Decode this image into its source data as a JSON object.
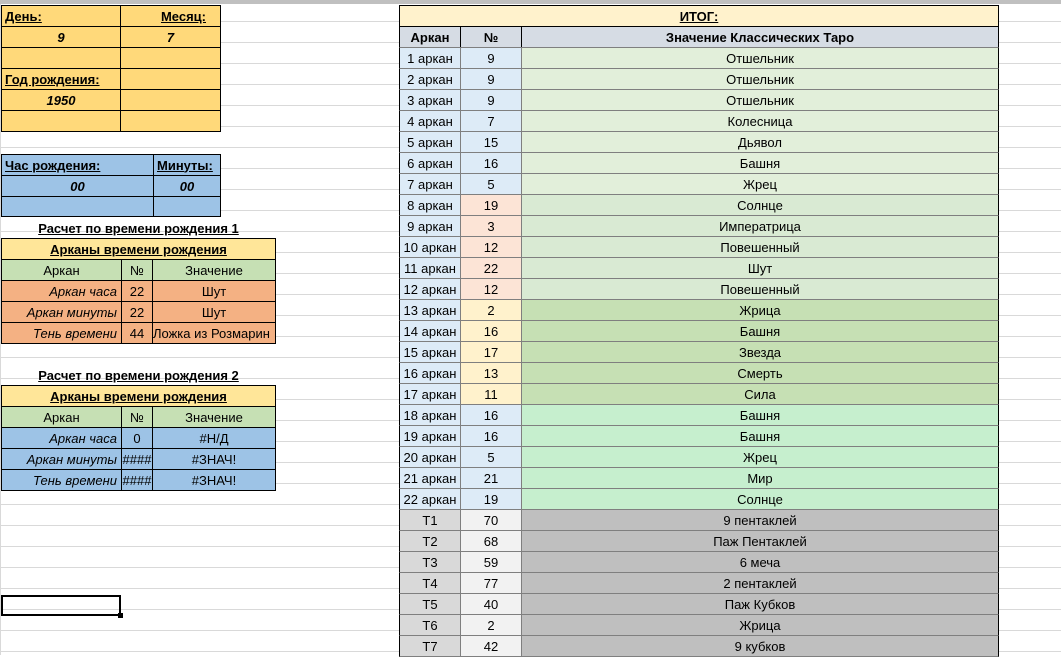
{
  "birth": {
    "day_label": "День:",
    "month_label": "Месяц:",
    "day_value": "9",
    "month_value": "7",
    "year_label": "Год рождения:",
    "year_value": "1950",
    "hour_label": "Час рождения:",
    "minutes_label": "Минуты:",
    "hour_value": "00",
    "minutes_value": "00"
  },
  "calc1": {
    "title": "Расчет по времени рождения 1",
    "header": "Арканы времени рождения",
    "col_arcan": "Аркан",
    "col_num": "№",
    "col_value": "Значение",
    "rows": [
      {
        "label": "Аркан часа",
        "num": "22",
        "value": "Шут"
      },
      {
        "label": "Аркан минуты",
        "num": "22",
        "value": "Шут"
      },
      {
        "label": "Тень времени",
        "num": "44",
        "value": "Ложка из Розмарин"
      }
    ]
  },
  "calc2": {
    "title": "Расчет по времени рождения 2",
    "header": "Арканы времени рождения",
    "col_arcan": "Аркан",
    "col_num": "№",
    "col_value": "Значение",
    "rows": [
      {
        "label": "Аркан часа",
        "num": "0",
        "value": "#Н/Д"
      },
      {
        "label": "Аркан минуты",
        "num": "####",
        "value": "#ЗНАЧ!"
      },
      {
        "label": "Тень времени",
        "num": "####",
        "value": "#ЗНАЧ!"
      }
    ]
  },
  "result": {
    "title": "ИТОГ:",
    "col_arcan": "Аркан",
    "col_num": "№",
    "col_meaning": "Значение Классических Таро",
    "rows": [
      {
        "arcan": "1 аркан",
        "num": "9",
        "meaning": "Отшельник"
      },
      {
        "arcan": "2 аркан",
        "num": "9",
        "meaning": "Отшельник"
      },
      {
        "arcan": "3 аркан",
        "num": "9",
        "meaning": "Отшельник"
      },
      {
        "arcan": "4 аркан",
        "num": "7",
        "meaning": "Колесница"
      },
      {
        "arcan": "5 аркан",
        "num": "15",
        "meaning": "Дьявол"
      },
      {
        "arcan": "6 аркан",
        "num": "16",
        "meaning": "Башня"
      },
      {
        "arcan": "7 аркан",
        "num": "5",
        "meaning": "Жрец"
      },
      {
        "arcan": "8 аркан",
        "num": "19",
        "meaning": "Солнце"
      },
      {
        "arcan": "9 аркан",
        "num": "3",
        "meaning": "Императрица"
      },
      {
        "arcan": "10 аркан",
        "num": "12",
        "meaning": "Повешенный"
      },
      {
        "arcan": "11 аркан",
        "num": "22",
        "meaning": "Шут"
      },
      {
        "arcan": "12 аркан",
        "num": "12",
        "meaning": "Повешенный"
      },
      {
        "arcan": "13 аркан",
        "num": "2",
        "meaning": "Жрица"
      },
      {
        "arcan": "14 аркан",
        "num": "16",
        "meaning": "Башня"
      },
      {
        "arcan": "15 аркан",
        "num": "17",
        "meaning": "Звезда"
      },
      {
        "arcan": "16 аркан",
        "num": "13",
        "meaning": "Смерть"
      },
      {
        "arcan": "17 аркан",
        "num": "11",
        "meaning": "Сила"
      },
      {
        "arcan": "18 аркан",
        "num": "16",
        "meaning": "Башня"
      },
      {
        "arcan": "19 аркан",
        "num": "16",
        "meaning": "Башня"
      },
      {
        "arcan": "20 аркан",
        "num": "5",
        "meaning": "Жрец"
      },
      {
        "arcan": "21 аркан",
        "num": "21",
        "meaning": "Мир"
      },
      {
        "arcan": "22 аркан",
        "num": "19",
        "meaning": "Солнце"
      },
      {
        "arcan": "T1",
        "num": "70",
        "meaning": "9 пентаклей"
      },
      {
        "arcan": "T2",
        "num": "68",
        "meaning": "Паж Пентаклей"
      },
      {
        "arcan": "T3",
        "num": "59",
        "meaning": "6 меча"
      },
      {
        "arcan": "T4",
        "num": "77",
        "meaning": "2 пентаклей"
      },
      {
        "arcan": "T5",
        "num": "40",
        "meaning": "Паж Кубков"
      },
      {
        "arcan": "T6",
        "num": "2",
        "meaning": "Жрица"
      },
      {
        "arcan": "T7",
        "num": "42",
        "meaning": "9 кубков"
      }
    ]
  },
  "colors": {
    "group1_num": "#ddebf7",
    "group1_meaning": "#e2efda",
    "group2_num": "#fce4d6",
    "group2_meaning": "#d9ead3",
    "group3_num": "#fff2cc",
    "group3_meaning": "#c6e0b4",
    "group4_num": "#ddebf7",
    "group4_meaning": "#c6efce",
    "t_num": "#f2f2f2",
    "t_meaning": "#bfbfbf"
  }
}
